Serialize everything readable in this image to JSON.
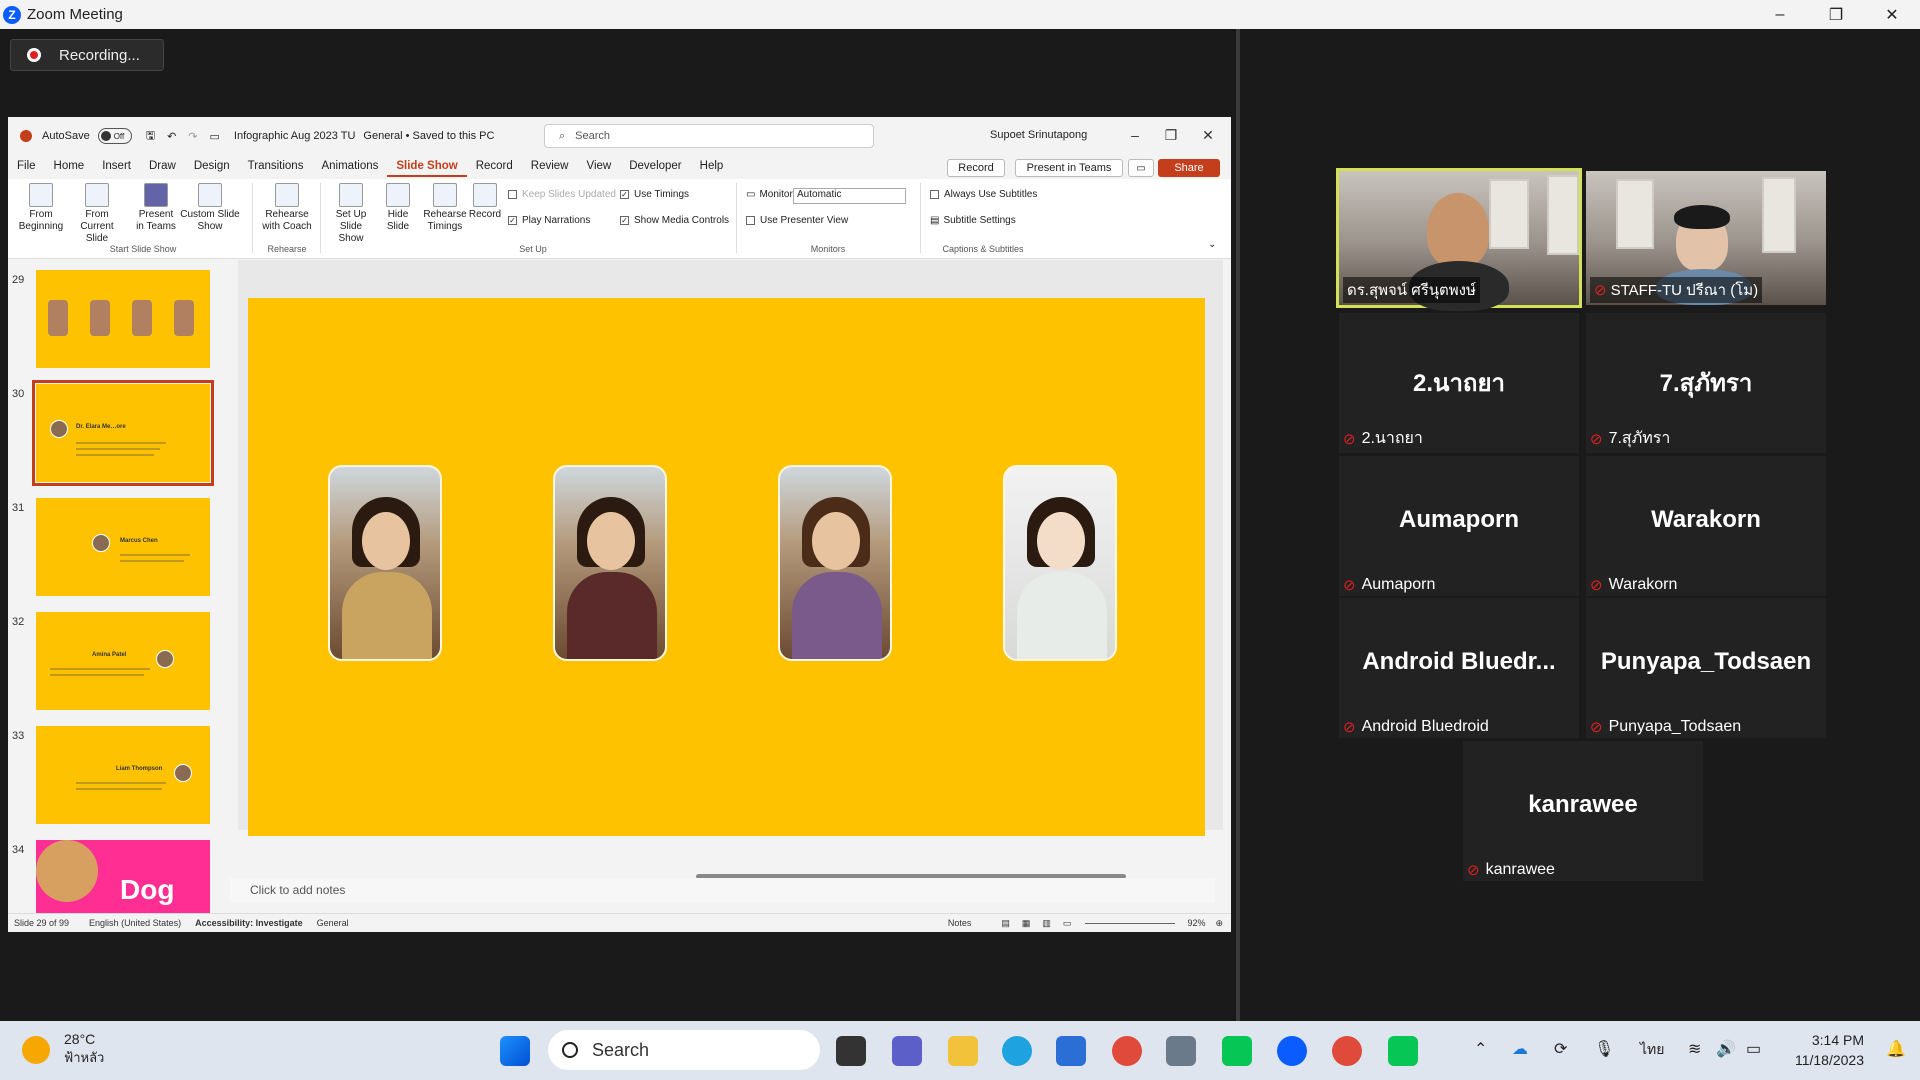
{
  "zoom": {
    "window_title": "Zoom Meeting",
    "recording_label": "Recording...",
    "window_controls": [
      "–",
      "❐",
      "✕"
    ]
  },
  "powerpoint": {
    "autosave_label": "AutoSave",
    "autosave_state": "Off",
    "file_title": "Infographic Aug 2023 TU",
    "sensitivity": "General • Saved to this PC",
    "search_placeholder": "Search",
    "user_name": "Supoet Srinutapong",
    "menu": [
      "File",
      "Home",
      "Insert",
      "Draw",
      "Design",
      "Transitions",
      "Animations",
      "Slide Show",
      "Record",
      "Review",
      "View",
      "Developer",
      "Help"
    ],
    "active_menu": "Slide Show",
    "record_btn": "Record",
    "present_teams_btn": "Present in Teams",
    "share_btn": "Share",
    "ribbon": {
      "from_beginning": "From Beginning",
      "from_current": "From Current Slide",
      "present_in_teams": "Present in Teams",
      "custom_slide_show": "Custom Slide Show",
      "group_start": "Start Slide Show",
      "rehearse_with_coach": "Rehearse with Coach",
      "group_rehearse": "Rehearse",
      "set_up_slide_show": "Set Up Slide Show",
      "hide_slide": "Hide Slide",
      "rehearse_timings": "Rehearse Timings",
      "record": "Record",
      "keep_slides_updated": "Keep Slides Updated",
      "use_timings": "Use Timings",
      "play_narrations": "Play Narrations",
      "show_media_controls": "Show Media Controls",
      "group_setup": "Set Up",
      "monitor_label": "Monitor:",
      "monitor_value": "Automatic",
      "use_presenter_view": "Use Presenter View",
      "group_monitors": "Monitors",
      "always_use_subtitles": "Always Use Subtitles",
      "subtitle_settings": "Subtitle Settings",
      "group_captions": "Captions & Subtitles"
    },
    "thumbnails": [
      {
        "num": "29",
        "title": ""
      },
      {
        "num": "30",
        "title": "Dr. Elara Me…ore"
      },
      {
        "num": "31",
        "title": "Marcus Chen"
      },
      {
        "num": "32",
        "title": "Amina Patel"
      },
      {
        "num": "33",
        "title": "Liam Thompson"
      },
      {
        "num": "34",
        "title": "Dog"
      }
    ],
    "notes_placeholder": "Click to add notes",
    "status": {
      "slide_count": "Slide 29 of 99",
      "language": "English (United States)",
      "accessibility": "Accessibility: Investigate",
      "sensitivity": "General",
      "notes": "Notes",
      "zoom": "92%"
    }
  },
  "participants": [
    {
      "display": "",
      "label": "ดร.สุพจน์ ศรีนุตพงษ์",
      "video": true,
      "muted": false,
      "active": true
    },
    {
      "display": "",
      "label": "STAFF-TU ปรีณา (โม)",
      "video": true,
      "muted": true,
      "active": false
    },
    {
      "display": "2.นาถยา",
      "label": "2.นาถยา",
      "video": false,
      "muted": true
    },
    {
      "display": "7.สุภัทรา",
      "label": "7.สุภัทรา",
      "video": false,
      "muted": true
    },
    {
      "display": "Aumaporn",
      "label": "Aumaporn",
      "video": false,
      "muted": true
    },
    {
      "display": "Warakorn",
      "label": "Warakorn",
      "video": false,
      "muted": true
    },
    {
      "display": "Android Bluedr...",
      "label": "Android Bluedroid",
      "video": false,
      "muted": true
    },
    {
      "display": "Punyapa_Todsaen",
      "label": "Punyapa_Todsaen",
      "video": false,
      "muted": true
    },
    {
      "display": "kanrawee",
      "label": "kanrawee",
      "video": false,
      "muted": true
    }
  ],
  "taskbar": {
    "temperature": "28°C",
    "weather": "ฟ้าหลัว",
    "search": "Search",
    "language": "ไทย",
    "time": "3:14 PM",
    "date": "11/18/2023"
  },
  "colors": {
    "slide_bg": "#fec200",
    "accent_ppt": "#c43e1c",
    "active_speaker": "#d4e157",
    "muted_red": "#e02020"
  }
}
